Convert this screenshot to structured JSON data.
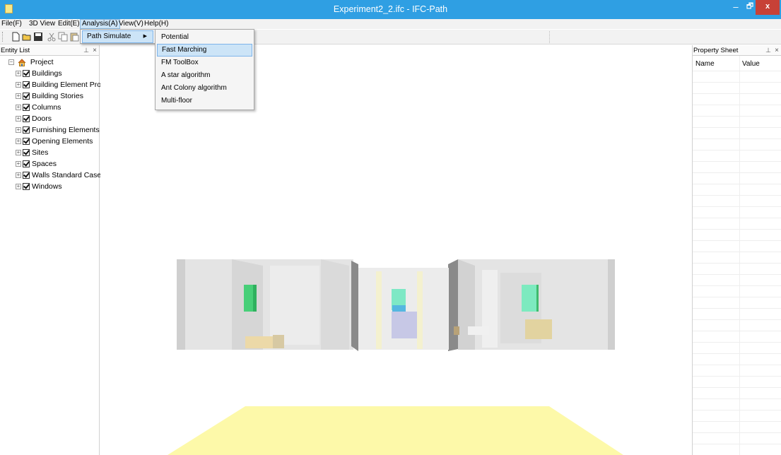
{
  "window": {
    "title": "Experiment2_2.ifc - IFC-Path",
    "min": "–",
    "max": "🗗",
    "close": "x"
  },
  "menubar": [
    {
      "label": "File(F)"
    },
    {
      "label": "3D View"
    },
    {
      "label": "Edit(E)"
    },
    {
      "label": "Analysis(A)",
      "active": true
    },
    {
      "label": "View(V)"
    },
    {
      "label": "Help(H)"
    }
  ],
  "analysis_menu": {
    "items": [
      {
        "label": "Path Simulate",
        "has_submenu": true
      }
    ]
  },
  "path_simulate_submenu": {
    "items": [
      {
        "label": "Potential"
      },
      {
        "label": "Fast Marching",
        "highlighted": true
      },
      {
        "label": "FM ToolBox"
      },
      {
        "label": "A star algorithm"
      },
      {
        "label": "Ant Colony algorithm"
      },
      {
        "label": "Multi-floor"
      }
    ]
  },
  "toolbar": {
    "icons": [
      "new-icon",
      "open-icon",
      "save-icon",
      "cut-icon",
      "copy-icon",
      "paste-icon"
    ]
  },
  "entity_list": {
    "title": "Entity List",
    "pin": "⊥",
    "close": "×",
    "root": "Project",
    "items": [
      "Buildings",
      "Building Element Proxie",
      "Building Stories",
      "Columns",
      "Doors",
      "Furnishing Elements",
      "Opening Elements",
      "Sites",
      "Spaces",
      "Walls Standard Cases",
      "Windows"
    ]
  },
  "property_sheet": {
    "title": "Property Sheet",
    "pin": "⊥",
    "close": "×",
    "columns": [
      "Name",
      "Value"
    ]
  },
  "colors": {
    "titlebar": "#2f9fe3",
    "close": "#c74137",
    "highlight": "#cce4f7",
    "floor": "#fdf9a9",
    "door_green": "#49d27c"
  }
}
